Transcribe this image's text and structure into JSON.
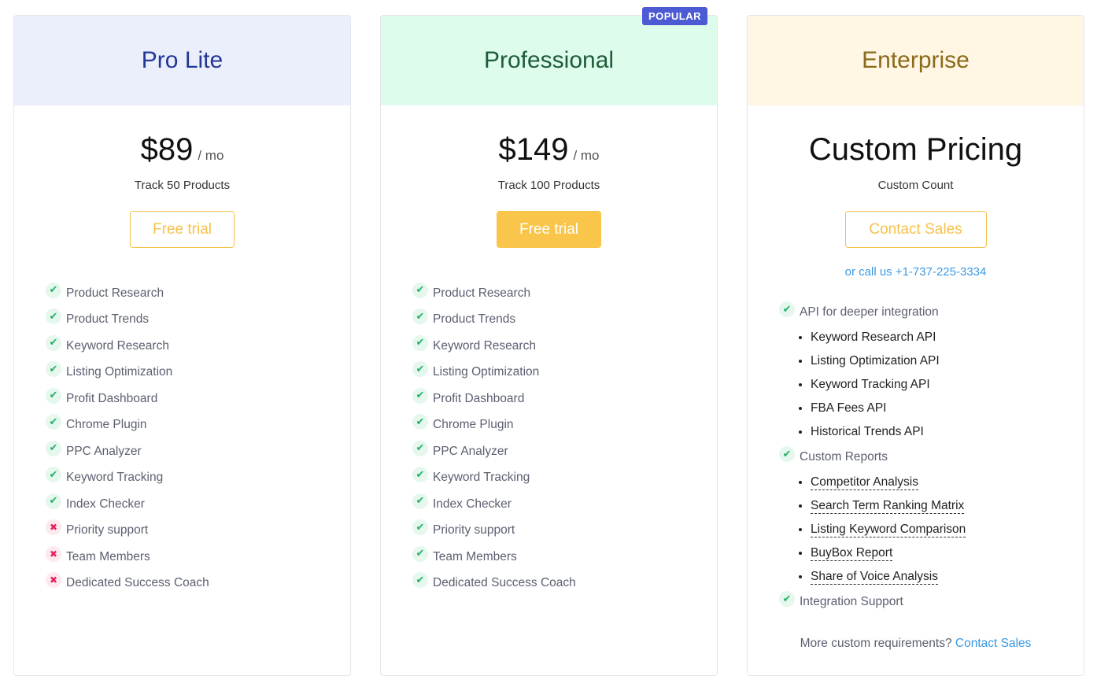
{
  "colors": {
    "prolite_header_bg": "#eaeffb",
    "prolite_title": "#233799",
    "professional_header_bg": "#ddfcec",
    "professional_title": "#1f5c3a",
    "enterprise_header_bg": "#fff6e3",
    "enterprise_title": "#8a6a1c",
    "accent_yellow": "#fac54b",
    "popular_badge": "#4c5bd4",
    "link_blue": "#3b9ae1",
    "check_green": "#22b36b",
    "cross_red": "#e2245b"
  },
  "plans": [
    {
      "name": "Pro Lite",
      "price": "$89",
      "period": "/ mo",
      "track": "Track 50 Products",
      "cta": "Free trial",
      "features": [
        {
          "label": "Product Research",
          "included": true,
          "icon": "check-icon"
        },
        {
          "label": "Product Trends",
          "included": true,
          "icon": "check-icon"
        },
        {
          "label": "Keyword Research",
          "included": true,
          "icon": "check-icon"
        },
        {
          "label": "Listing Optimization",
          "included": true,
          "icon": "check-icon"
        },
        {
          "label": "Profit Dashboard",
          "included": true,
          "icon": "check-icon"
        },
        {
          "label": "Chrome Plugin",
          "included": true,
          "icon": "check-icon"
        },
        {
          "label": "PPC Analyzer",
          "included": true,
          "icon": "check-icon"
        },
        {
          "label": "Keyword Tracking",
          "included": true,
          "icon": "check-icon"
        },
        {
          "label": "Index Checker",
          "included": true,
          "icon": "check-icon"
        },
        {
          "label": "Priority support",
          "included": false,
          "icon": "cross-icon"
        },
        {
          "label": "Team Members",
          "included": false,
          "icon": "cross-icon"
        },
        {
          "label": "Dedicated Success Coach",
          "included": false,
          "icon": "cross-icon"
        }
      ]
    },
    {
      "name": "Professional",
      "badge": "POPULAR",
      "price": "$149",
      "period": "/ mo",
      "track": "Track 100 Products",
      "cta": "Free trial",
      "features": [
        {
          "label": "Product Research",
          "included": true,
          "icon": "check-icon"
        },
        {
          "label": "Product Trends",
          "included": true,
          "icon": "check-icon"
        },
        {
          "label": "Keyword Research",
          "included": true,
          "icon": "check-icon"
        },
        {
          "label": "Listing Optimization",
          "included": true,
          "icon": "check-icon"
        },
        {
          "label": "Profit Dashboard",
          "included": true,
          "icon": "check-icon"
        },
        {
          "label": "Chrome Plugin",
          "included": true,
          "icon": "check-icon"
        },
        {
          "label": "PPC Analyzer",
          "included": true,
          "icon": "check-icon"
        },
        {
          "label": "Keyword Tracking",
          "included": true,
          "icon": "check-icon"
        },
        {
          "label": "Index Checker",
          "included": true,
          "icon": "check-icon"
        },
        {
          "label": "Priority support",
          "included": true,
          "icon": "check-icon"
        },
        {
          "label": "Team Members",
          "included": true,
          "icon": "check-icon"
        },
        {
          "label": "Dedicated Success Coach",
          "included": true,
          "icon": "check-icon"
        }
      ]
    },
    {
      "name": "Enterprise",
      "price": "Custom Pricing",
      "track": "Custom Count",
      "cta": "Contact Sales",
      "call": "or call us +1-737-225-3334",
      "groups": [
        {
          "label": "API for deeper integration",
          "icon": "check-icon",
          "items": [
            "Keyword Research API",
            "Listing Optimization API",
            "Keyword Tracking API",
            "FBA Fees API",
            "Historical Trends API"
          ]
        },
        {
          "label": "Custom Reports",
          "icon": "check-icon",
          "items": [
            "Competitor Analysis",
            "Search Term Ranking Matrix",
            "Listing Keyword Comparison",
            "BuyBox Report",
            "Share of Voice Analysis"
          ]
        },
        {
          "label": "Integration Support",
          "icon": "check-icon",
          "items": []
        }
      ],
      "more_text": "More custom requirements?",
      "more_link": "Contact Sales"
    }
  ]
}
